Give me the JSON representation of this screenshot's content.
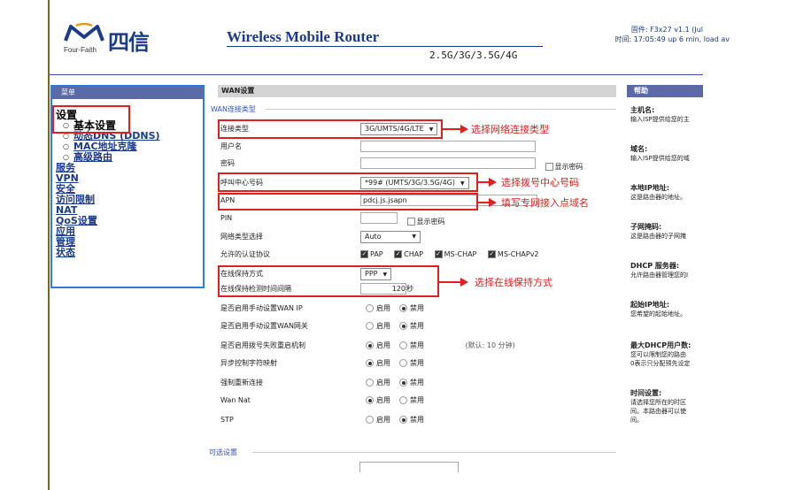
{
  "header": {
    "logo_cn": "四信",
    "logo_en": "Four-Faith",
    "router_title": "Wireless Mobile Router",
    "bands": "2.5G/3G/3.5G/4G",
    "firmware": "固件: F3x27 v1.1 (Jul",
    "uptime": "时间: 17:05:49 up 6 min, load av"
  },
  "sidebar": {
    "title": "菜单",
    "groups": [
      {
        "label": "设置"
      },
      {
        "label": "基本设置"
      },
      {
        "label": "动态DNS (DDNS)"
      },
      {
        "label": "MAC地址克隆"
      },
      {
        "label": "高级路由"
      },
      {
        "label": "服务"
      },
      {
        "label": "VPN"
      },
      {
        "label": "安全"
      },
      {
        "label": "访问限制"
      },
      {
        "label": "NAT"
      },
      {
        "label": "QoS设置"
      },
      {
        "label": "应用"
      },
      {
        "label": "管理"
      },
      {
        "label": "状态"
      }
    ]
  },
  "main": {
    "title": "WAN设置",
    "legend": "WAN连接类型",
    "rows": {
      "conn_type": {
        "label": "连接类型",
        "value": "3G/UMTS/4G/LTE"
      },
      "username": {
        "label": "用户名",
        "value": ""
      },
      "password": {
        "label": "密码",
        "value": "",
        "show": "显示密码"
      },
      "dial": {
        "label": "呼叫中心号码",
        "value": "*99# (UMTS/3G/3.5G/4G)"
      },
      "apn": {
        "label": "APN",
        "value": "pdcj.js.jsapn"
      },
      "pin": {
        "label": "PIN",
        "value": "",
        "show": "显示密码"
      },
      "net_type": {
        "label": "网络类型选择",
        "value": "Auto"
      },
      "auth": {
        "label": "允许的认证协议",
        "opts": [
          "PAP",
          "CHAP",
          "MS-CHAP",
          "MS-CHAPv2"
        ]
      },
      "keepalive": {
        "label": "在线保持方式",
        "value": "PPP"
      },
      "interval": {
        "label": "在线保持检测时间间隔",
        "value": "120",
        "unit": "秒"
      },
      "manual_ip": {
        "label": "是否启用手动设置WAN IP"
      },
      "manual_gw": {
        "label": "是否启用手动设置WAN网关"
      },
      "reboot": {
        "label": "是否启用拨号失败重启机制",
        "hint": "(默认: 10 分钟)"
      },
      "async": {
        "label": "异步控制字符映射"
      },
      "force": {
        "label": "强制重新连接"
      },
      "wannat": {
        "label": "Wan Nat"
      },
      "stp": {
        "label": "STP"
      }
    },
    "enable": "启用",
    "disable": "禁用",
    "optional_legend": "可选设置"
  },
  "annotations": {
    "a1": "选择网络连接类型",
    "a2": "选择拨号中心号码",
    "a3": "填写专网接入点域名",
    "a4": "选择在线保持方式"
  },
  "help": {
    "title": "帮助",
    "items": [
      {
        "h": "主机名:",
        "d": "输入ISP提供给您的主"
      },
      {
        "h": "域名:",
        "d": "输入ISP提供给您的域"
      },
      {
        "h": "本地IP地址:",
        "d": "这是路由器的地址。"
      },
      {
        "h": "子网掩码:",
        "d": "这是路由器的子网掩"
      },
      {
        "h": "DHCP 服务器:",
        "d": "允许路由器管理您的I"
      },
      {
        "h": "起始IP地址:",
        "d": "您希望的起始地址。"
      },
      {
        "h": "最大DHCP用户数:",
        "d": "您可以限制您的路由",
        "d2": "0表示只分配预先设定"
      },
      {
        "h": "时间设置:",
        "d": "请选择您所在的时区",
        "d2": "间。本路由器可以使",
        "d3": "间。"
      }
    ]
  },
  "colors": {
    "accent": "#1a3b8c",
    "annotation": "#e02020",
    "sidebar_border": "#2e7bd6"
  }
}
